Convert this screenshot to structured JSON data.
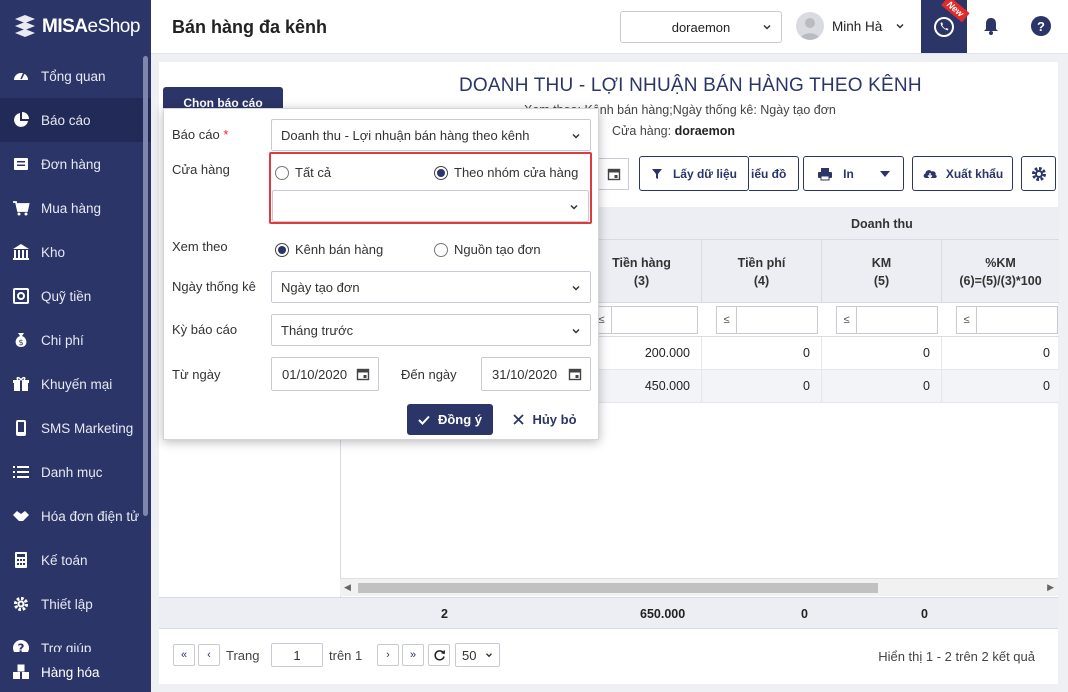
{
  "app": {
    "brand_bold": "MISA",
    "brand_light": "eShop"
  },
  "sidebar": {
    "items": [
      {
        "label": "Tổng quan",
        "icon": "dashboard-icon"
      },
      {
        "label": "Báo cáo",
        "icon": "pie-chart-icon"
      },
      {
        "label": "Đơn hàng",
        "icon": "order-icon"
      },
      {
        "label": "Mua hàng",
        "icon": "cart-icon"
      },
      {
        "label": "Kho",
        "icon": "warehouse-icon"
      },
      {
        "label": "Quỹ tiền",
        "icon": "safe-icon"
      },
      {
        "label": "Chi phí",
        "icon": "money-bag-icon"
      },
      {
        "label": "Khuyến mại",
        "icon": "gift-icon"
      },
      {
        "label": "SMS Marketing",
        "icon": "phone-icon"
      },
      {
        "label": "Danh mục",
        "icon": "list-icon"
      },
      {
        "label": "Hóa đơn điện tử",
        "icon": "handshake-icon"
      },
      {
        "label": "Kế toán",
        "icon": "calculator-icon"
      },
      {
        "label": "Thiết lập",
        "icon": "gear-icon"
      },
      {
        "label": "Trợ giúp",
        "icon": "help-icon"
      }
    ],
    "active_index": 1,
    "bottom_label": "Hàng hóa"
  },
  "header": {
    "page_title": "Bán hàng đa kênh",
    "store_value": "doraemon",
    "user_name": "Minh Hà",
    "new_badge": "New"
  },
  "report": {
    "choose_button": "Chọn báo cáo",
    "title": "DOANH THU - LỢI NHUẬN BÁN HÀNG THEO KÊNH",
    "subtitle": "Xem theo: Kênh bán hàng;Ngày thống kê: Ngày tạo đơn",
    "store_label": "Cửa hàng:",
    "store_value": "doraemon"
  },
  "toolbar": {
    "fetch": "Lấy dữ liệu",
    "chart": "iểu đồ",
    "print": "In",
    "export": "Xuất khẩu"
  },
  "grid": {
    "group_header": "Doanh thu",
    "columns": [
      {
        "line1": "Tiền hàng",
        "line2": "(3)"
      },
      {
        "line1": "Tiền phí",
        "line2": "(4)"
      },
      {
        "line1": "KM",
        "line2": "(5)"
      },
      {
        "line1": "%KM",
        "line2": "(6)=(5)/(3)*100"
      }
    ],
    "filter_op": "≤",
    "rows": [
      [
        "200.000",
        "0",
        "0",
        "0"
      ],
      [
        "450.000",
        "0",
        "0",
        "0"
      ]
    ],
    "totals": {
      "count": "2",
      "tien_hang": "650.000",
      "tien_phi": "0",
      "km": "0"
    }
  },
  "pager": {
    "page_label": "Trang",
    "page_value": "1",
    "of_label": "trên 1",
    "page_size": "50",
    "summary": "Hiển thị 1 - 2 trên 2 kết quả"
  },
  "popup": {
    "report_label": "Báo cáo",
    "report_required": "*",
    "report_value": "Doanh thu - Lợi nhuận bán hàng theo kênh",
    "store_label": "Cửa hàng",
    "store_opt_all": "Tất cả",
    "store_opt_group": "Theo nhóm cửa hàng",
    "store_group_value": "",
    "view_label": "Xem theo",
    "view_opt_channel": "Kênh bán hàng",
    "view_opt_source": "Nguồn tạo đơn",
    "stat_date_label": "Ngày thống kê",
    "stat_date_value": "Ngày tạo đơn",
    "period_label": "Kỳ báo cáo",
    "period_value": "Tháng trước",
    "from_label": "Từ ngày",
    "from_value": "01/10/2020",
    "to_label": "Đến ngày",
    "to_value": "31/10/2020",
    "ok": "Đồng ý",
    "cancel": "Hủy bỏ"
  },
  "colors": {
    "primary": "#2c3568",
    "highlight": "#e0393e",
    "badge": "#e02b2b"
  }
}
